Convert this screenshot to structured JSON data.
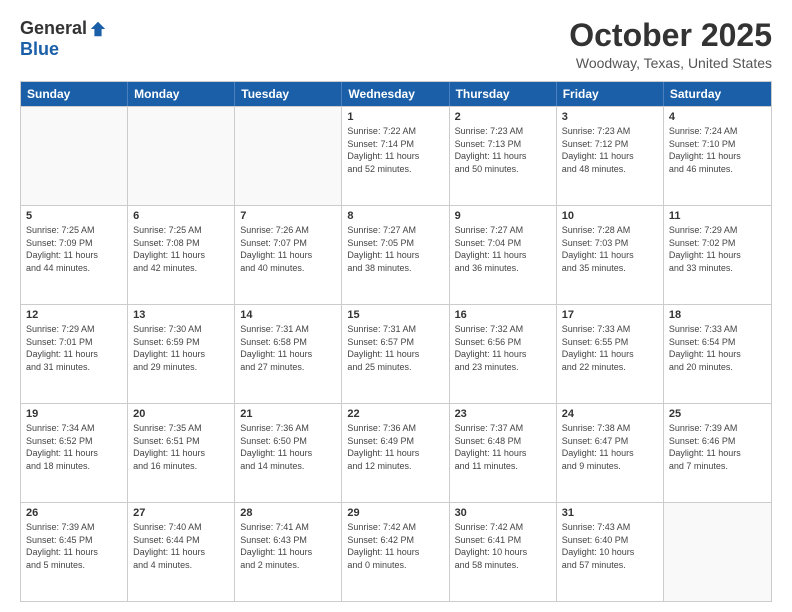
{
  "header": {
    "logo_general": "General",
    "logo_blue": "Blue",
    "month_title": "October 2025",
    "location": "Woodway, Texas, United States"
  },
  "weekdays": [
    "Sunday",
    "Monday",
    "Tuesday",
    "Wednesday",
    "Thursday",
    "Friday",
    "Saturday"
  ],
  "weeks": [
    [
      {
        "day": "",
        "info": "",
        "empty": true
      },
      {
        "day": "",
        "info": "",
        "empty": true
      },
      {
        "day": "",
        "info": "",
        "empty": true
      },
      {
        "day": "1",
        "info": "Sunrise: 7:22 AM\nSunset: 7:14 PM\nDaylight: 11 hours\nand 52 minutes."
      },
      {
        "day": "2",
        "info": "Sunrise: 7:23 AM\nSunset: 7:13 PM\nDaylight: 11 hours\nand 50 minutes."
      },
      {
        "day": "3",
        "info": "Sunrise: 7:23 AM\nSunset: 7:12 PM\nDaylight: 11 hours\nand 48 minutes."
      },
      {
        "day": "4",
        "info": "Sunrise: 7:24 AM\nSunset: 7:10 PM\nDaylight: 11 hours\nand 46 minutes."
      }
    ],
    [
      {
        "day": "5",
        "info": "Sunrise: 7:25 AM\nSunset: 7:09 PM\nDaylight: 11 hours\nand 44 minutes."
      },
      {
        "day": "6",
        "info": "Sunrise: 7:25 AM\nSunset: 7:08 PM\nDaylight: 11 hours\nand 42 minutes."
      },
      {
        "day": "7",
        "info": "Sunrise: 7:26 AM\nSunset: 7:07 PM\nDaylight: 11 hours\nand 40 minutes."
      },
      {
        "day": "8",
        "info": "Sunrise: 7:27 AM\nSunset: 7:05 PM\nDaylight: 11 hours\nand 38 minutes."
      },
      {
        "day": "9",
        "info": "Sunrise: 7:27 AM\nSunset: 7:04 PM\nDaylight: 11 hours\nand 36 minutes."
      },
      {
        "day": "10",
        "info": "Sunrise: 7:28 AM\nSunset: 7:03 PM\nDaylight: 11 hours\nand 35 minutes."
      },
      {
        "day": "11",
        "info": "Sunrise: 7:29 AM\nSunset: 7:02 PM\nDaylight: 11 hours\nand 33 minutes."
      }
    ],
    [
      {
        "day": "12",
        "info": "Sunrise: 7:29 AM\nSunset: 7:01 PM\nDaylight: 11 hours\nand 31 minutes."
      },
      {
        "day": "13",
        "info": "Sunrise: 7:30 AM\nSunset: 6:59 PM\nDaylight: 11 hours\nand 29 minutes."
      },
      {
        "day": "14",
        "info": "Sunrise: 7:31 AM\nSunset: 6:58 PM\nDaylight: 11 hours\nand 27 minutes."
      },
      {
        "day": "15",
        "info": "Sunrise: 7:31 AM\nSunset: 6:57 PM\nDaylight: 11 hours\nand 25 minutes."
      },
      {
        "day": "16",
        "info": "Sunrise: 7:32 AM\nSunset: 6:56 PM\nDaylight: 11 hours\nand 23 minutes."
      },
      {
        "day": "17",
        "info": "Sunrise: 7:33 AM\nSunset: 6:55 PM\nDaylight: 11 hours\nand 22 minutes."
      },
      {
        "day": "18",
        "info": "Sunrise: 7:33 AM\nSunset: 6:54 PM\nDaylight: 11 hours\nand 20 minutes."
      }
    ],
    [
      {
        "day": "19",
        "info": "Sunrise: 7:34 AM\nSunset: 6:52 PM\nDaylight: 11 hours\nand 18 minutes."
      },
      {
        "day": "20",
        "info": "Sunrise: 7:35 AM\nSunset: 6:51 PM\nDaylight: 11 hours\nand 16 minutes."
      },
      {
        "day": "21",
        "info": "Sunrise: 7:36 AM\nSunset: 6:50 PM\nDaylight: 11 hours\nand 14 minutes."
      },
      {
        "day": "22",
        "info": "Sunrise: 7:36 AM\nSunset: 6:49 PM\nDaylight: 11 hours\nand 12 minutes."
      },
      {
        "day": "23",
        "info": "Sunrise: 7:37 AM\nSunset: 6:48 PM\nDaylight: 11 hours\nand 11 minutes."
      },
      {
        "day": "24",
        "info": "Sunrise: 7:38 AM\nSunset: 6:47 PM\nDaylight: 11 hours\nand 9 minutes."
      },
      {
        "day": "25",
        "info": "Sunrise: 7:39 AM\nSunset: 6:46 PM\nDaylight: 11 hours\nand 7 minutes."
      }
    ],
    [
      {
        "day": "26",
        "info": "Sunrise: 7:39 AM\nSunset: 6:45 PM\nDaylight: 11 hours\nand 5 minutes."
      },
      {
        "day": "27",
        "info": "Sunrise: 7:40 AM\nSunset: 6:44 PM\nDaylight: 11 hours\nand 4 minutes."
      },
      {
        "day": "28",
        "info": "Sunrise: 7:41 AM\nSunset: 6:43 PM\nDaylight: 11 hours\nand 2 minutes."
      },
      {
        "day": "29",
        "info": "Sunrise: 7:42 AM\nSunset: 6:42 PM\nDaylight: 11 hours\nand 0 minutes."
      },
      {
        "day": "30",
        "info": "Sunrise: 7:42 AM\nSunset: 6:41 PM\nDaylight: 10 hours\nand 58 minutes."
      },
      {
        "day": "31",
        "info": "Sunrise: 7:43 AM\nSunset: 6:40 PM\nDaylight: 10 hours\nand 57 minutes."
      },
      {
        "day": "",
        "info": "",
        "empty": true
      }
    ]
  ]
}
